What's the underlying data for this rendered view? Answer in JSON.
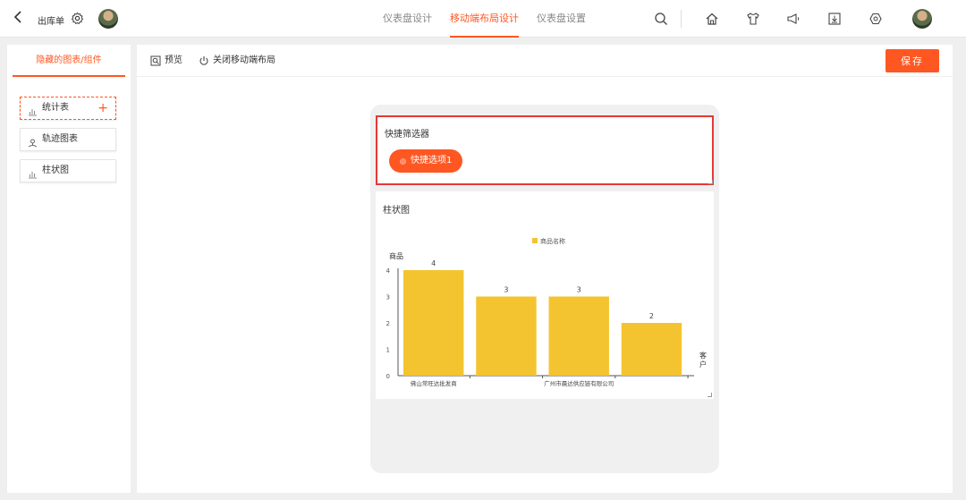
{
  "header": {
    "title": "出库单",
    "tabs": [
      {
        "label": "仪表盘设计",
        "active": false
      },
      {
        "label": "移动端布局设计",
        "active": true
      },
      {
        "label": "仪表盘设置",
        "active": false
      }
    ]
  },
  "sidebar": {
    "tab_label": "隐藏的图表/组件",
    "items": [
      {
        "label": "统计表",
        "icon": "bar-chart-icon",
        "selected": true
      },
      {
        "label": "轨迹图表",
        "icon": "trajectory-icon",
        "selected": false
      },
      {
        "label": "柱状图",
        "icon": "bar-chart-icon",
        "selected": false
      }
    ]
  },
  "toolbar": {
    "preview_label": "预览",
    "close_mobile_label": "关闭移动端布局",
    "save_label": "保存"
  },
  "filter_card": {
    "title": "快捷筛选器",
    "option_label": "快捷选项1"
  },
  "bar_card": {
    "title": "柱状图"
  },
  "colors": {
    "accent": "#ff5722",
    "bar": "#f4c430",
    "selection_border": "#e53935"
  },
  "chart_data": {
    "type": "bar",
    "categories": [
      "佛山常旺达批发商",
      "",
      "广州市晨达供应链有限公司",
      ""
    ],
    "values": [
      4,
      3,
      3,
      2
    ],
    "series": [
      {
        "name": "商品名称",
        "values": [
          4,
          3,
          3,
          2
        ]
      }
    ],
    "ylabel": "商品",
    "xlabel": "客户",
    "yticks": [
      0,
      1,
      2,
      3,
      4
    ],
    "ylim": [
      0,
      4
    ],
    "data_labels": [
      "4",
      "3",
      "3",
      "2"
    ],
    "legend_position": "top-center",
    "grid": false
  }
}
